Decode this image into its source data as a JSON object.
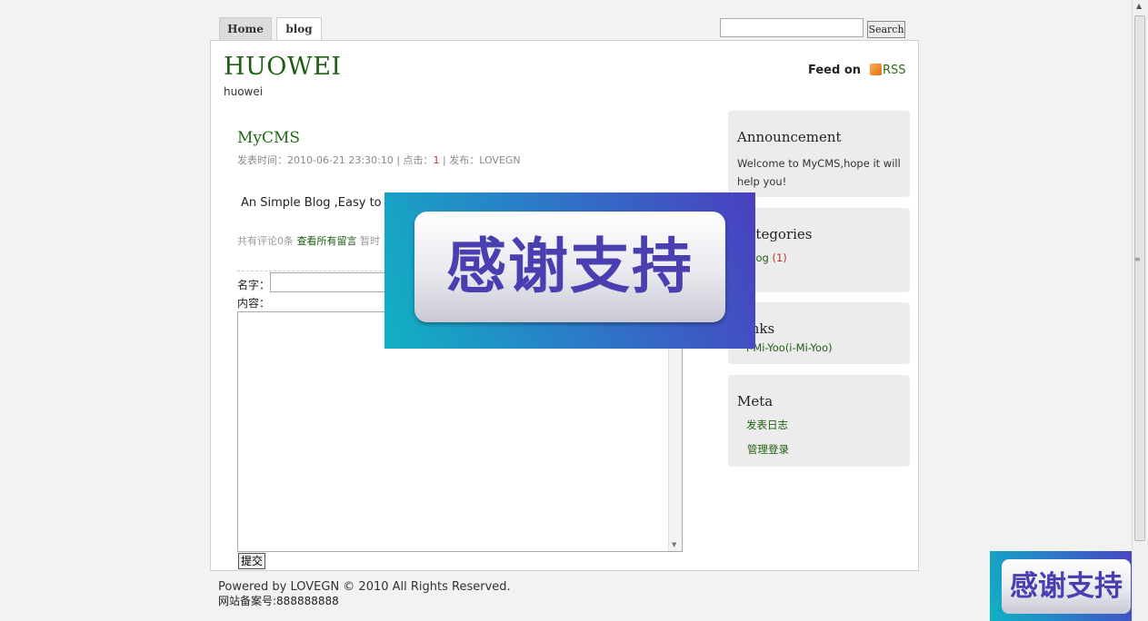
{
  "nav": {
    "home": "Home",
    "blog": "blog"
  },
  "search": {
    "placeholder": "",
    "button": "Search"
  },
  "site": {
    "title": "HUOWEI",
    "subtitle": "huowei",
    "feed_label": "Feed on",
    "rss_label": "RSS"
  },
  "post": {
    "title": "MyCMS",
    "meta_prefix": "发表时间：2010-06-21 23:30:10 | 点击：",
    "clicks": "1",
    "meta_suffix": " | 发布：LOVEGN",
    "body": "An Simple Blog ,Easy to L",
    "comments_prefix": "共有评论0条 ",
    "comments_link": "查看所有留言",
    "comments_suffix": " 暂时"
  },
  "form": {
    "name_label": "名字：",
    "content_label": "内容：",
    "submit": "提交"
  },
  "sidebar": {
    "announcement": {
      "title": "Announcement",
      "text": "Welcome to MyCMS,hope it will help you!"
    },
    "categories": {
      "title": "Categories",
      "item": "blog",
      "count": "(1)"
    },
    "links": {
      "title": "Links",
      "item": "i-Mi-Yoo(i-Mi-Yoo)"
    },
    "meta": {
      "title": "Meta",
      "items": [
        "发表日志",
        "管理登录"
      ]
    }
  },
  "footer": {
    "powered": "Powered by LOVEGN © 2010 All Rights Reserved.",
    "icp": "网站备案号:888888888"
  },
  "overlay": {
    "thanks_text": "感谢支持"
  }
}
